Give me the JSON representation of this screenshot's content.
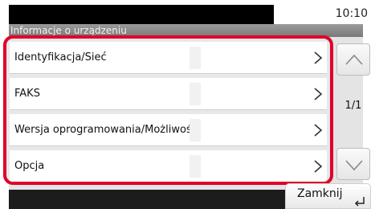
{
  "status": {
    "time": "10:10"
  },
  "title": "Informacje o urządzeniu",
  "menu": [
    {
      "label": "Identyfikacja/Sieć"
    },
    {
      "label": "FAKS"
    },
    {
      "label": "Wersja oprogramowania/Możliwości"
    },
    {
      "label": "Opcja"
    }
  ],
  "pagination": {
    "label": "1/1"
  },
  "footer": {
    "close_label": "Zamknij"
  },
  "colors": {
    "highlight": "#e0002a",
    "title_bar": "#8a8a8a"
  },
  "icons": {
    "row_arrow": "chevron-right-icon",
    "up": "chevron-up-icon",
    "down": "chevron-down-icon",
    "enter": "enter-icon"
  }
}
